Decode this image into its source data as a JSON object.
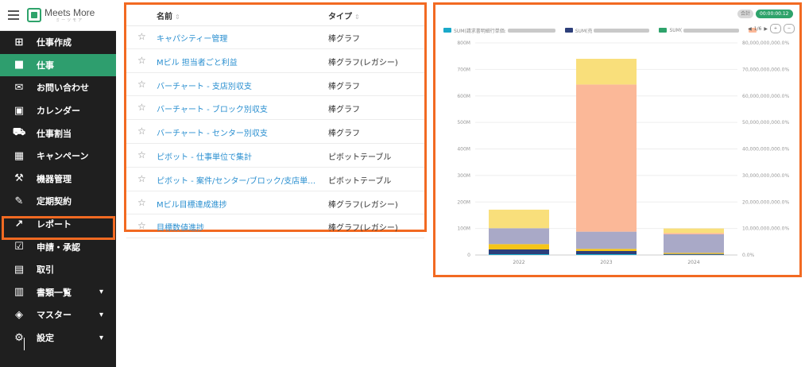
{
  "app": {
    "logo_text": "Meets More",
    "logo_sub": "ミーツモア"
  },
  "sidebar": {
    "items": [
      {
        "label": "仕事作成",
        "icon": "briefcase-plus-icon",
        "glyph": "⊞",
        "active": false,
        "chevron": false
      },
      {
        "label": "仕事",
        "icon": "briefcase-icon",
        "glyph": "■",
        "active": true,
        "chevron": false
      },
      {
        "label": "お問い合わせ",
        "icon": "mail-icon",
        "glyph": "✉",
        "active": false,
        "chevron": false
      },
      {
        "label": "カレンダー",
        "icon": "calendar-icon",
        "glyph": "▣",
        "active": false,
        "chevron": false
      },
      {
        "label": "仕事割当",
        "icon": "truck-icon",
        "glyph": "⛟",
        "active": false,
        "chevron": false
      },
      {
        "label": "キャンペーン",
        "icon": "building-icon",
        "glyph": "▦",
        "active": false,
        "chevron": false
      },
      {
        "label": "機器管理",
        "icon": "tools-icon",
        "glyph": "⚒",
        "active": false,
        "chevron": false
      },
      {
        "label": "定期契約",
        "icon": "contract-icon",
        "glyph": "✎",
        "active": false,
        "chevron": false
      },
      {
        "label": "レポート",
        "icon": "chart-line-icon",
        "glyph": "↗",
        "active": false,
        "chevron": false
      },
      {
        "label": "申請・承認",
        "icon": "check-square-icon",
        "glyph": "☑",
        "active": false,
        "chevron": false
      },
      {
        "label": "取引",
        "icon": "calculator-icon",
        "glyph": "▤",
        "active": false,
        "chevron": false
      },
      {
        "label": "書類一覧",
        "icon": "documents-icon",
        "glyph": "▥",
        "active": false,
        "chevron": true
      },
      {
        "label": "マスター",
        "icon": "boxes-icon",
        "glyph": "◈",
        "active": false,
        "chevron": true
      },
      {
        "label": "設定",
        "icon": "gear-icon",
        "glyph": "⚙",
        "active": false,
        "chevron": true
      }
    ]
  },
  "report_list": {
    "header_name": "名前",
    "header_type": "タイプ",
    "rows": [
      {
        "name": "キャパシティー管理",
        "type": "棒グラフ"
      },
      {
        "name": "Mビル 担当者ごと利益",
        "type": "棒グラフ(レガシー)"
      },
      {
        "name": "バーチャート - 支店別収支",
        "type": "棒グラフ"
      },
      {
        "name": "バーチャート - ブロック別収支",
        "type": "棒グラフ"
      },
      {
        "name": "バーチャート - センター別収支",
        "type": "棒グラフ"
      },
      {
        "name": "ピボット - 仕事単位で集計",
        "type": "ピボットテーブル"
      },
      {
        "name": "ピボット - 案件/センター/ブロック/支店単位...",
        "type": "ピボットテーブル"
      },
      {
        "name": "Mビル目標達成進捗",
        "type": "棒グラフ(レガシー)"
      },
      {
        "name": "目標数値進捗",
        "type": "棒グラフ(レガシー)"
      }
    ]
  },
  "chart_header": {
    "pill_grey": "合計",
    "pill_green": "00:00:00.12",
    "pager_text": "1/6"
  },
  "chart_data": {
    "type": "bar",
    "categories": [
      "2022",
      "2023",
      "2024"
    ],
    "series": [
      {
        "name": "SUM(請求書明細行単価:",
        "color": "#1aa9c9",
        "values": [
          3000000,
          3000000,
          1000000
        ]
      },
      {
        "name": "SUM(売",
        "color": "#2d3f7a",
        "values": [
          18000000,
          12000000,
          3000000
        ]
      },
      {
        "name": "SUM(",
        "color": "#2ea36b",
        "values": [
          0,
          0,
          0
        ]
      },
      {
        "name": "",
        "color": "#f5c518",
        "values": [
          20000000,
          8000000,
          4000000
        ]
      },
      {
        "name": "",
        "color": "#a9a9c7",
        "values": [
          60000000,
          65000000,
          70000000
        ]
      },
      {
        "name": "",
        "color": "#fbb898",
        "values": [
          0,
          555000000,
          5000000
        ]
      },
      {
        "name": "",
        "color": "#f9df7b",
        "values": [
          70000000,
          97000000,
          17000000
        ]
      }
    ],
    "ylim": [
      0,
      800000000
    ],
    "y_ticks": [
      "0",
      "100M",
      "200M",
      "300M",
      "400M",
      "500M",
      "600M",
      "700M",
      "800M"
    ],
    "y2_ticks": [
      "0.0%",
      "10,000,000,000.0%",
      "20,000,000,000.0%",
      "30,000,000,000.0%",
      "40,000,000,000.0%",
      "50,000,000,000.0%",
      "60,000,000,000.0%",
      "70,000,000,000.0%",
      "80,000,000,000.0%"
    ],
    "grid": true,
    "legend_position": "top"
  }
}
